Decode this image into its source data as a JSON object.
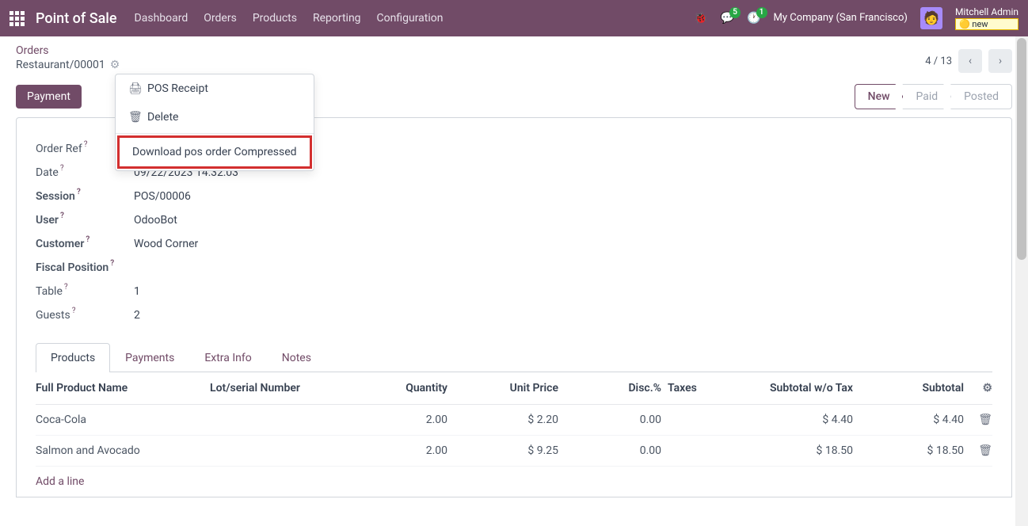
{
  "brand": "Point of Sale",
  "topnav": [
    "Dashboard",
    "Orders",
    "Products",
    "Reporting",
    "Configuration"
  ],
  "msg_badge": "5",
  "act_badge": "1",
  "company": "My Company (San Francisco)",
  "user_name": "Mitchell Admin",
  "user_badge": "new",
  "breadcrumb_parent": "Orders",
  "breadcrumb_current": "Restaurant/00001",
  "pager": "4 / 13",
  "primary_btn": "Payment",
  "status": {
    "new": "New",
    "paid": "Paid",
    "posted": "Posted"
  },
  "fields": {
    "order_ref": {
      "label": "Order Ref",
      "value": ""
    },
    "date": {
      "label": "Date",
      "value": "09/22/2023 14:32:03"
    },
    "session": {
      "label": "Session",
      "value": "POS/00006"
    },
    "user": {
      "label": "User",
      "value": "OdooBot"
    },
    "customer": {
      "label": "Customer",
      "value": "Wood Corner"
    },
    "fiscal": {
      "label": "Fiscal Position",
      "value": ""
    },
    "table": {
      "label": "Table",
      "value": "1"
    },
    "guests": {
      "label": "Guests",
      "value": "2"
    }
  },
  "tabs": [
    "Products",
    "Payments",
    "Extra Info",
    "Notes"
  ],
  "thead": {
    "name": "Full Product Name",
    "lot": "Lot/serial Number",
    "qty": "Quantity",
    "price": "Unit Price",
    "disc": "Disc.%",
    "tax": "Taxes",
    "subwo": "Subtotal w/o Tax",
    "sub": "Subtotal"
  },
  "rows": [
    {
      "name": "Coca-Cola",
      "qty": "2.00",
      "price": "$ 2.20",
      "disc": "0.00",
      "subwo": "$ 4.40",
      "sub": "$ 4.40"
    },
    {
      "name": "Salmon and Avocado",
      "qty": "2.00",
      "price": "$ 9.25",
      "disc": "0.00",
      "subwo": "$ 18.50",
      "sub": "$ 18.50"
    }
  ],
  "add_line": "Add a line",
  "dropdown": {
    "receipt": "POS Receipt",
    "delete": "Delete",
    "download": "Download pos order Compressed"
  }
}
